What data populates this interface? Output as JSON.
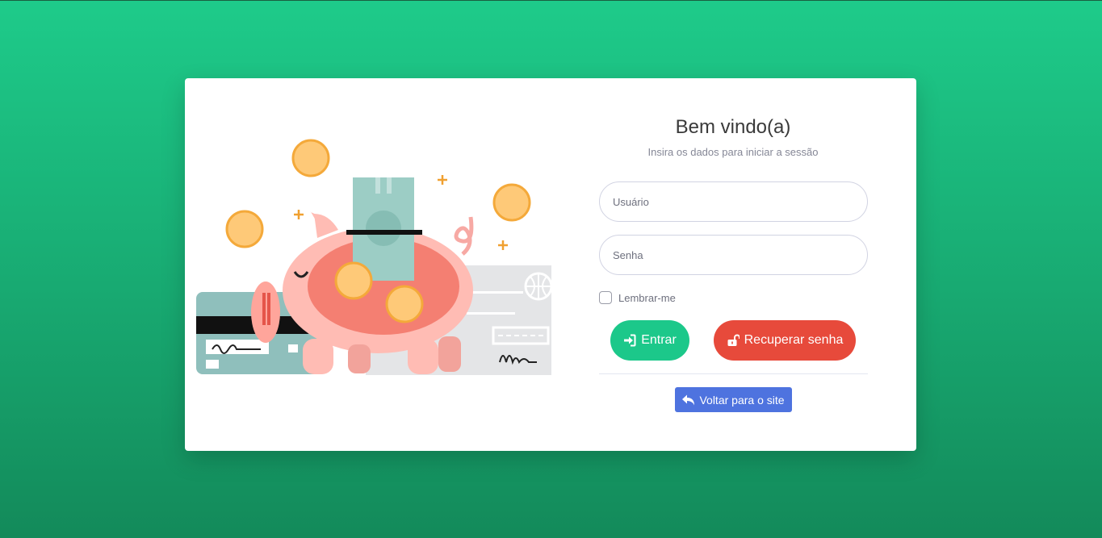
{
  "login": {
    "title": "Bem vindo(a)",
    "subtitle": "Insira os dados para iniciar a sessão",
    "username_placeholder": "Usuário",
    "password_placeholder": "Senha",
    "remember_label": "Lembrar-me",
    "enter_label": "Entrar",
    "recover_label": "Recuperar senha",
    "back_label": "Voltar para o site"
  },
  "icons": {
    "enter": "sign-in-icon",
    "recover": "unlock-icon",
    "back": "reply-arrow-icon"
  },
  "colors": {
    "background": "#1ecb8a",
    "enter_button": "#1cc88a",
    "recover_button": "#e74a3b",
    "back_button": "#4e73df"
  }
}
